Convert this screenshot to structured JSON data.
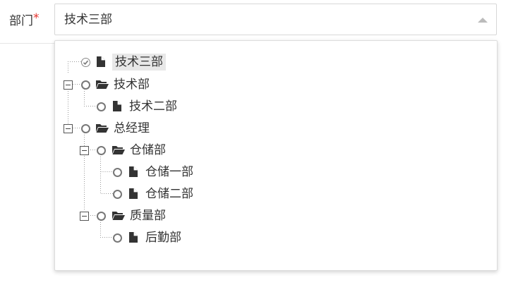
{
  "form": {
    "label": "部门",
    "required_mark": "*",
    "select_value": "技术三部"
  },
  "tree": {
    "selected_node": "技术三部",
    "nodes": {
      "tech3": {
        "label": "技术三部",
        "type": "file",
        "checked": true
      },
      "tech": {
        "label": "技术部",
        "type": "folder",
        "expanded": true
      },
      "tech2": {
        "label": "技术二部",
        "type": "file"
      },
      "gm": {
        "label": "总经理",
        "type": "folder",
        "expanded": true
      },
      "storage": {
        "label": "仓储部",
        "type": "folder",
        "expanded": true
      },
      "storage1": {
        "label": "仓储一部",
        "type": "file"
      },
      "storage2": {
        "label": "仓储二部",
        "type": "file"
      },
      "quality": {
        "label": "质量部",
        "type": "folder",
        "expanded": true
      },
      "logistics": {
        "label": "后勤部",
        "type": "file"
      }
    }
  },
  "icons": {
    "folder": "folder-open-icon",
    "file": "file-icon",
    "toggle": "minus-square-icon",
    "radio": "radio-icon"
  },
  "colors": {
    "required": "#e5322d",
    "selected_bg": "#e8e8e8",
    "border": "#d7d7d7"
  }
}
